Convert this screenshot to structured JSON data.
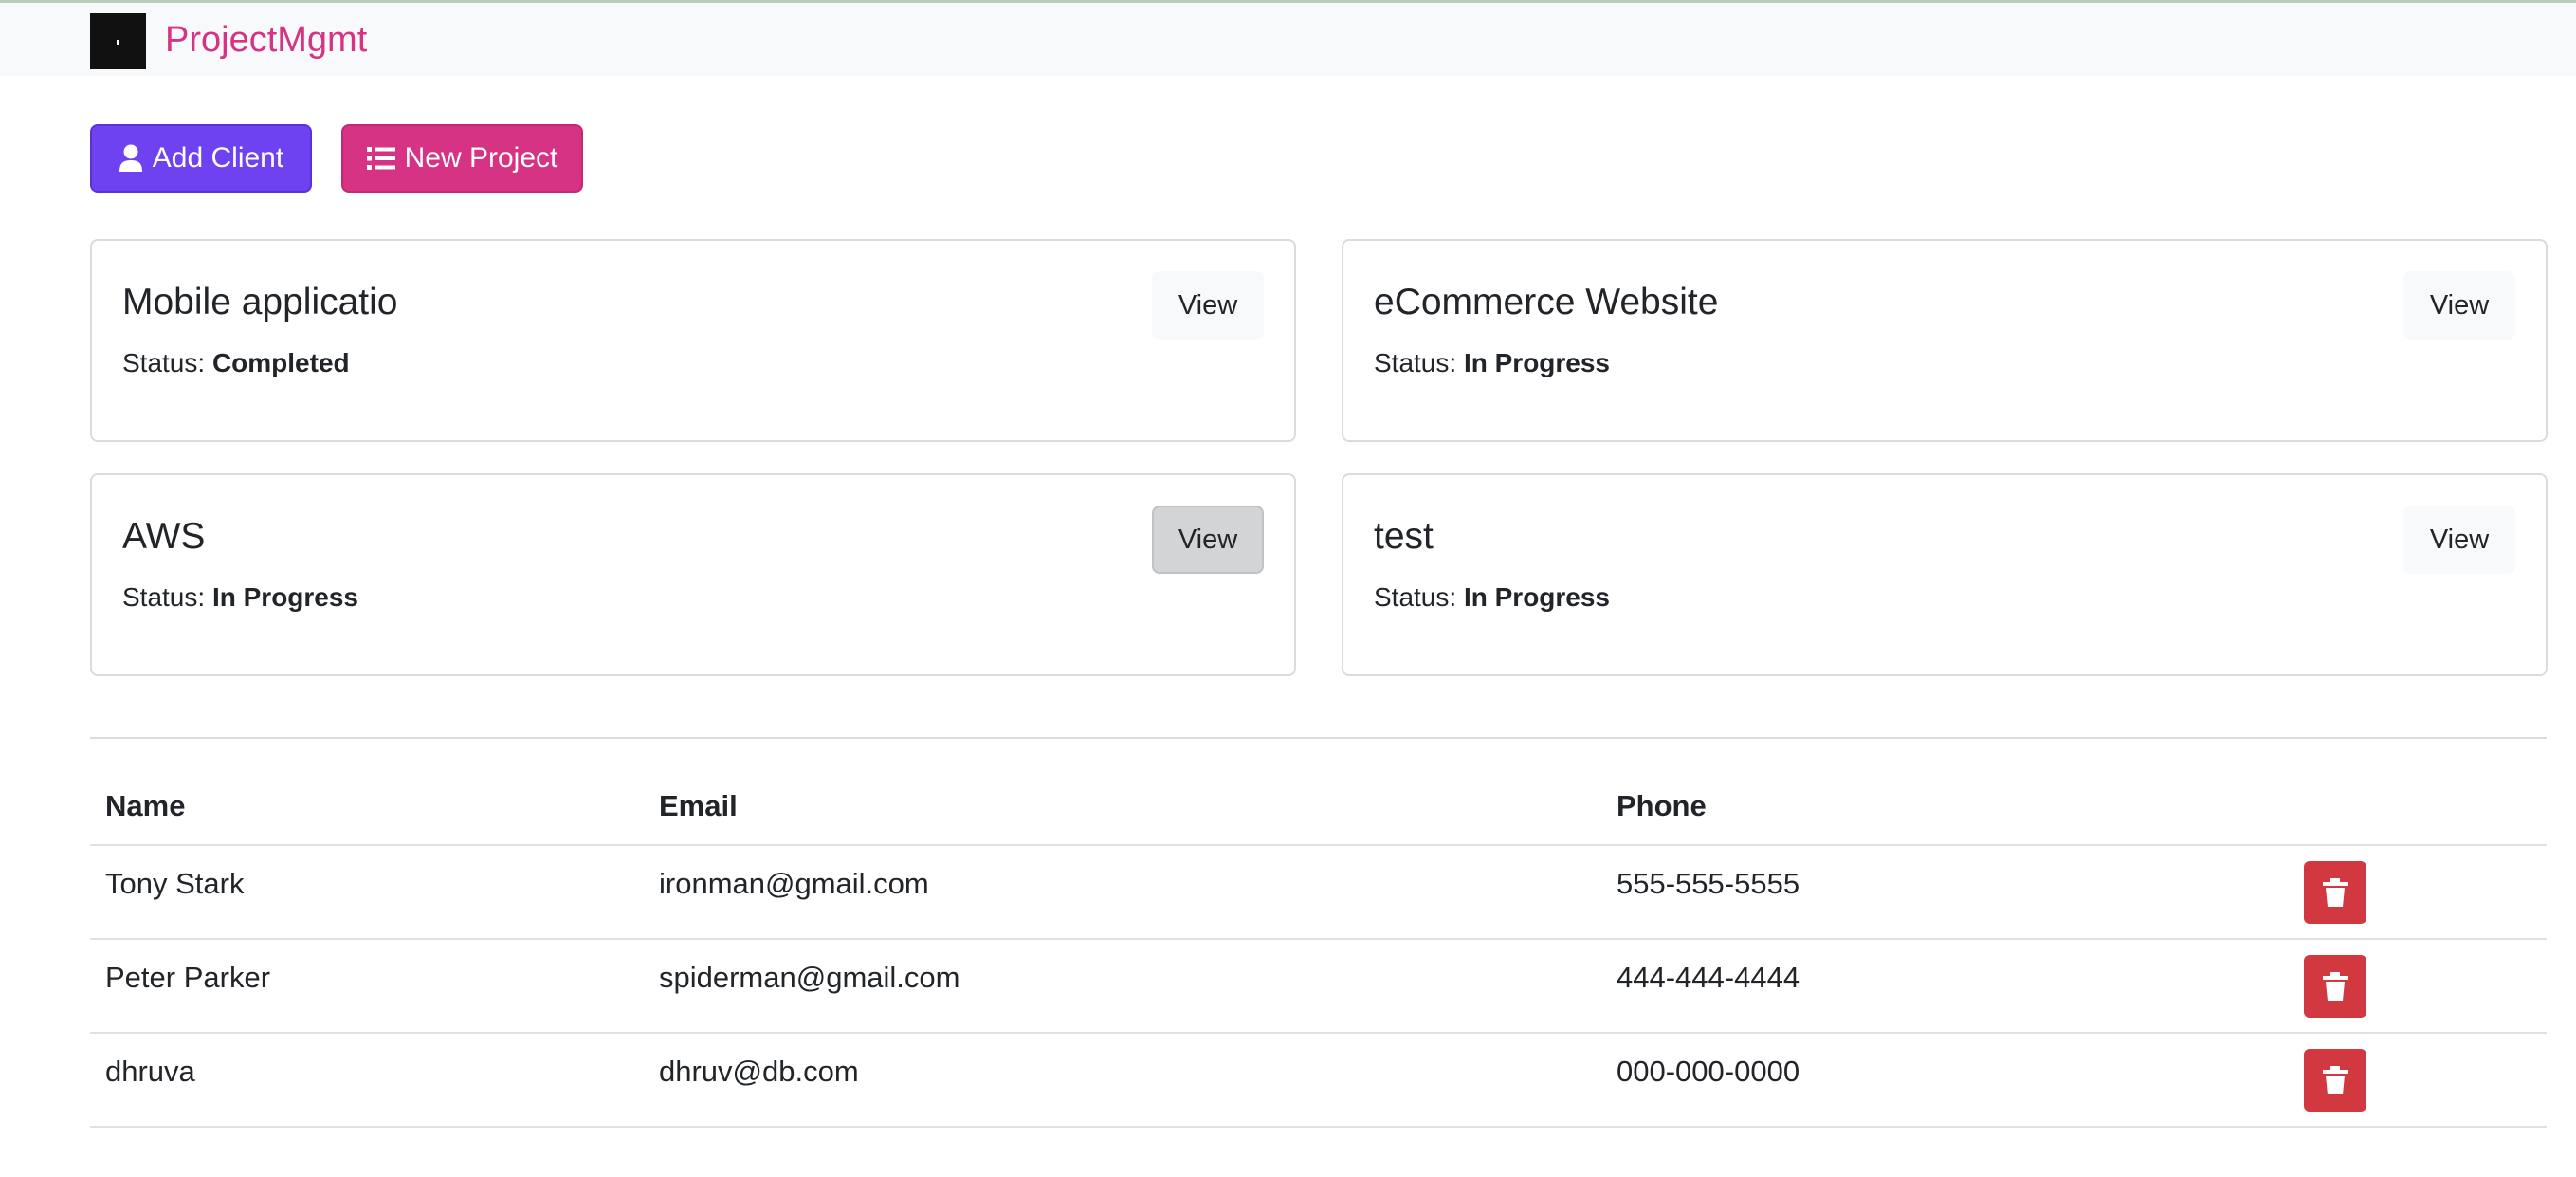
{
  "navbar": {
    "brand": "ProjectMgmt"
  },
  "actions": {
    "add_client_label": "Add Client",
    "new_project_label": "New Project"
  },
  "projects": [
    {
      "name": "Mobile applicatio",
      "status_label": "Status:",
      "status": "Completed",
      "view_label": "View"
    },
    {
      "name": "eCommerce Website",
      "status_label": "Status:",
      "status": "In Progress",
      "view_label": "View"
    },
    {
      "name": "AWS",
      "status_label": "Status:",
      "status": "In Progress",
      "view_label": "View"
    },
    {
      "name": "test",
      "status_label": "Status:",
      "status": "In Progress",
      "view_label": "View"
    }
  ],
  "clients": {
    "columns": [
      "Name",
      "Email",
      "Phone"
    ],
    "rows": [
      {
        "name": "Tony Stark",
        "email": "ironman@gmail.com",
        "phone": "555-555-5555"
      },
      {
        "name": "Peter Parker",
        "email": "spiderman@gmail.com",
        "phone": "444-444-4444"
      },
      {
        "name": "dhruva",
        "email": "dhruv@db.com",
        "phone": "000-000-0000"
      }
    ]
  },
  "colors": {
    "brand": "#d63384",
    "add_client": "#6f42f1",
    "new_project": "#d63384",
    "delete": "#d1383f"
  },
  "icons": {
    "add_client": "user-icon",
    "new_project": "list-icon",
    "delete": "trash-icon"
  }
}
